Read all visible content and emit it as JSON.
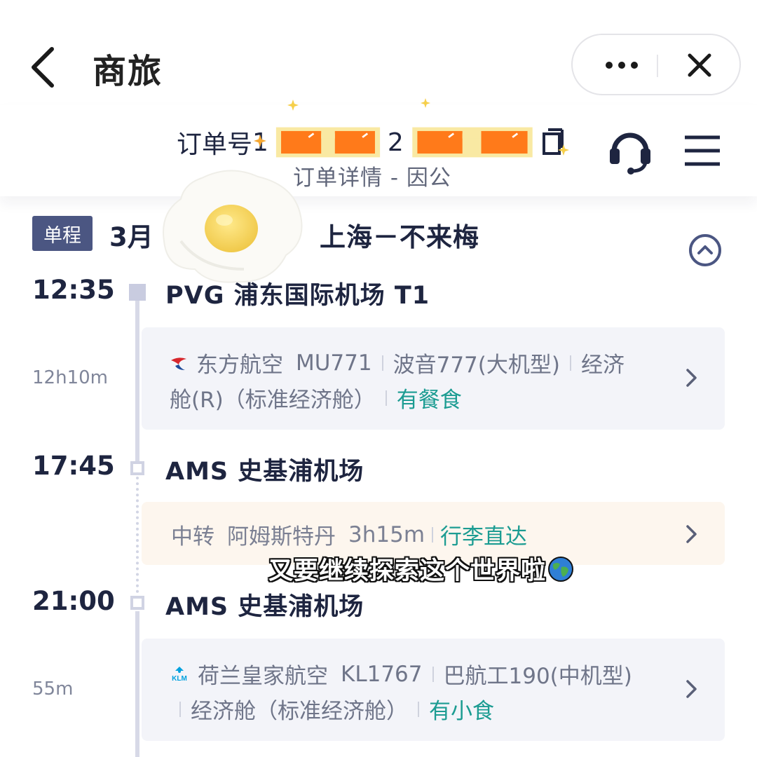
{
  "nav": {
    "title": "商旅"
  },
  "order": {
    "label": "订单号",
    "visible_digits": [
      "1",
      "2"
    ],
    "subtitle": "订单详情 - 因公"
  },
  "trip": {
    "type_badge": "单程",
    "date_partial": "3月",
    "route": "上海－不来梅"
  },
  "segments": [
    {
      "dep_time": "12:35",
      "dep_airport": "PVG 浦东国际机场 T1",
      "duration": "12h10m",
      "airline_logo": "china-eastern-logo",
      "airline": "东方航空",
      "flight_no": "MU771",
      "aircraft": "波音777(大机型)",
      "cabin_line1": "经济",
      "cabin_line2": "舱(R)（标准经济舱）",
      "meal": "有餐食"
    },
    {
      "arr_time": "17:45",
      "arr_airport": "AMS 史基浦机场"
    }
  ],
  "transfer": {
    "label": "中转",
    "city": "阿姆斯特丹",
    "duration": "3h15m",
    "baggage": "行李直达"
  },
  "segment2": {
    "dep_time": "21:00",
    "dep_airport": "AMS 史基浦机场",
    "duration": "55m",
    "airline_logo": "klm-logo",
    "airline": "荷兰皇家航空",
    "flight_no": "KL1767",
    "aircraft": "巴航工190(中机型)",
    "cabin": "经济舱（标准经济舱）",
    "meal": "有小食"
  },
  "overlay": {
    "caption": "又要继续探索这个世界啦"
  },
  "colors": {
    "primary_text": "#1e2540",
    "badge_bg": "#4b5682",
    "green": "#1c9c92",
    "card_bg": "#f3f4f9",
    "transfer_bg": "#fdf6ee",
    "timeline": "#d7d9e7",
    "sticker_orange": "#ff7a1a",
    "sticker_frame": "#f9e9a3"
  }
}
